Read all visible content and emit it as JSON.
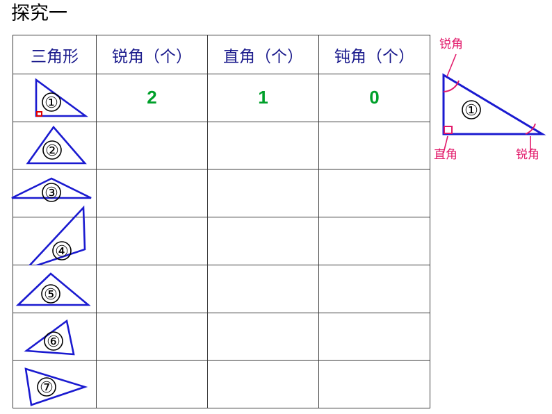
{
  "page": {
    "title": "探究一",
    "background": "#ffffff"
  },
  "colors": {
    "shape_stroke": "#1a1ad0",
    "header_text": "#1a1a8c",
    "count_text": "#00a02a",
    "annotation": "#e2196a",
    "right_angle_mark": "#e00000",
    "grid": "#3a3a3a",
    "title_text": "#000000"
  },
  "table": {
    "headers": [
      {
        "key": "shape",
        "label": "三角形"
      },
      {
        "key": "acute",
        "label": "锐角（个）"
      },
      {
        "key": "right",
        "label": "直角（个）"
      },
      {
        "key": "obtuse",
        "label": "钝角（个）"
      }
    ],
    "rows": [
      {
        "shape_label": "①",
        "shape_kind": "right-triangle",
        "acute": "2",
        "right": "1",
        "obtuse": "0"
      },
      {
        "shape_label": "②",
        "shape_kind": "equilateral-triangle",
        "acute": "",
        "right": "",
        "obtuse": ""
      },
      {
        "shape_label": "③",
        "shape_kind": "wide-flat-triangle",
        "acute": "",
        "right": "",
        "obtuse": ""
      },
      {
        "shape_label": "④",
        "shape_kind": "sliver-triangle",
        "acute": "",
        "right": "",
        "obtuse": ""
      },
      {
        "shape_label": "⑤",
        "shape_kind": "broad-acute-triangle",
        "acute": "",
        "right": "",
        "obtuse": ""
      },
      {
        "shape_label": "⑥",
        "shape_kind": "tilted-triangle",
        "acute": "",
        "right": "",
        "obtuse": ""
      },
      {
        "shape_label": "⑦",
        "shape_kind": "right-pointing-triangle",
        "acute": "",
        "right": "",
        "obtuse": ""
      }
    ]
  },
  "diagram": {
    "shape_label": "①",
    "shape_kind": "right-triangle-annotated",
    "annotations": {
      "top_vertex": "锐角",
      "bottom_left_vertex": "直角",
      "bottom_right_vertex": "锐角"
    }
  }
}
